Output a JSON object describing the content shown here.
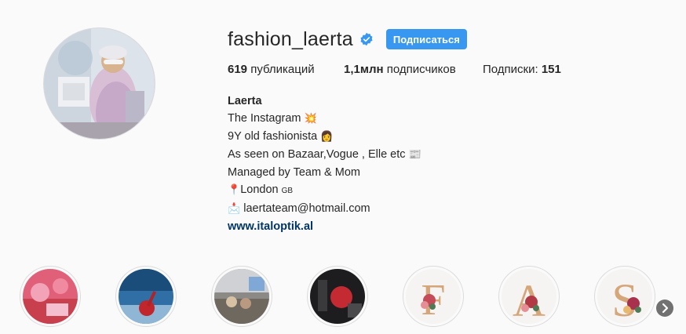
{
  "profile": {
    "username": "fashion_laerta",
    "verified_icon": "verified-badge-icon",
    "follow_label": "Подписаться",
    "accent_color": "#3897f0"
  },
  "stats": {
    "posts_count": "619",
    "posts_label": "публикаций",
    "followers_count": "1,1млн",
    "followers_label": "подписчиков",
    "following_label": "Подписки:",
    "following_count": "151"
  },
  "bio": {
    "name": "Laerta",
    "line1": "The Instagram",
    "line1_emoji": "💥",
    "line2": "9Y old fashionista",
    "line2_emoji": "👩",
    "line3": "As seen on Bazaar,Vogue , Elle etc",
    "line3_emoji": "📰",
    "line4": "Managed by Team & Mom",
    "location_emoji": "📍",
    "location": "London",
    "location_flag": "GB",
    "email_emoji": "📩",
    "email": "laertateam@hotmail.com",
    "website": "www.italoptik.al"
  },
  "highlights": [
    {
      "icon": "highlight-cover-pink-toys"
    },
    {
      "icon": "highlight-cover-sky-city"
    },
    {
      "icon": "highlight-cover-fashion-show"
    },
    {
      "icon": "highlight-cover-dark-event"
    },
    {
      "icon": "highlight-cover-letter-f",
      "letter": "F"
    },
    {
      "icon": "highlight-cover-letter-a",
      "letter": "A"
    },
    {
      "icon": "highlight-cover-letter-s",
      "letter": "S"
    }
  ],
  "next_icon": "chevron-right-icon"
}
